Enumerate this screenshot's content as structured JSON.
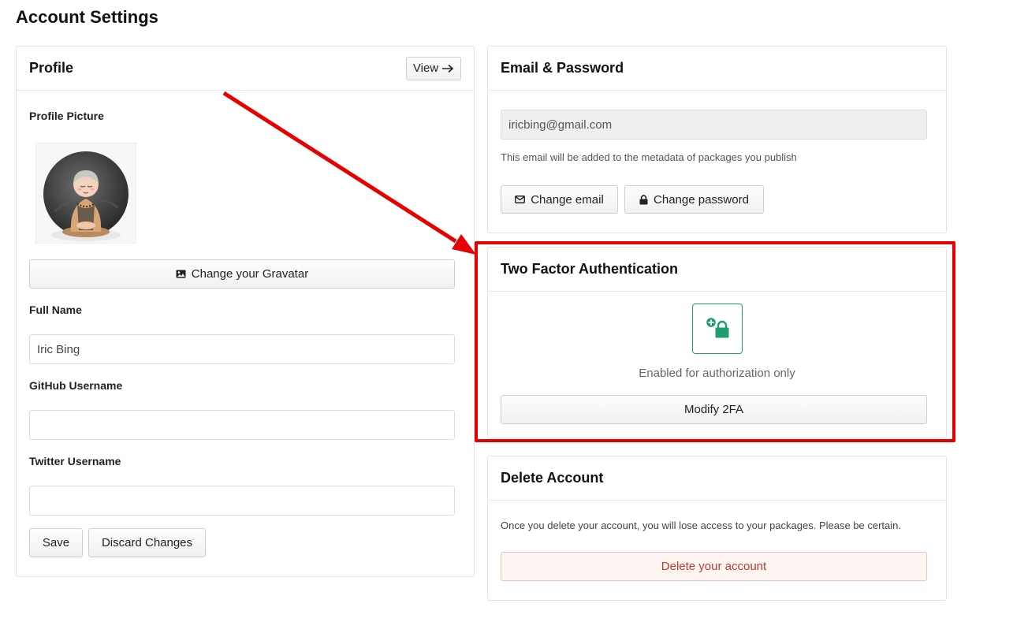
{
  "page": {
    "title": "Account Settings"
  },
  "profile": {
    "title": "Profile",
    "view_label": "View",
    "picture_label": "Profile Picture",
    "gravatar_button": "Change your Gravatar",
    "full_name_label": "Full Name",
    "full_name_value": "Iric Bing",
    "github_label": "GitHub Username",
    "github_value": "",
    "twitter_label": "Twitter Username",
    "twitter_value": "",
    "save_label": "Save",
    "discard_label": "Discard Changes"
  },
  "email_password": {
    "title": "Email & Password",
    "email_value": "iricbing@gmail.com",
    "helper_text": "This email will be added to the metadata of packages you publish",
    "change_email_label": "Change email",
    "change_password_label": "Change password"
  },
  "two_factor": {
    "title": "Two Factor Authentication",
    "status_text": "Enabled for authorization only",
    "modify_label": "Modify 2FA",
    "accent_color": "#1e9e6a"
  },
  "delete_account": {
    "title": "Delete Account",
    "warning_text": "Once you delete your account, you will lose access to your packages. Please be certain.",
    "delete_label": "Delete your account",
    "danger_color": "#c0392b"
  },
  "annotation": {
    "highlight_color": "#e60000"
  },
  "icons": {
    "view_arrow": "arrow-right-icon",
    "gravatar": "image-icon",
    "change_email": "envelope-icon",
    "change_password": "lock-icon",
    "two_factor": "lock-plus-icon"
  }
}
